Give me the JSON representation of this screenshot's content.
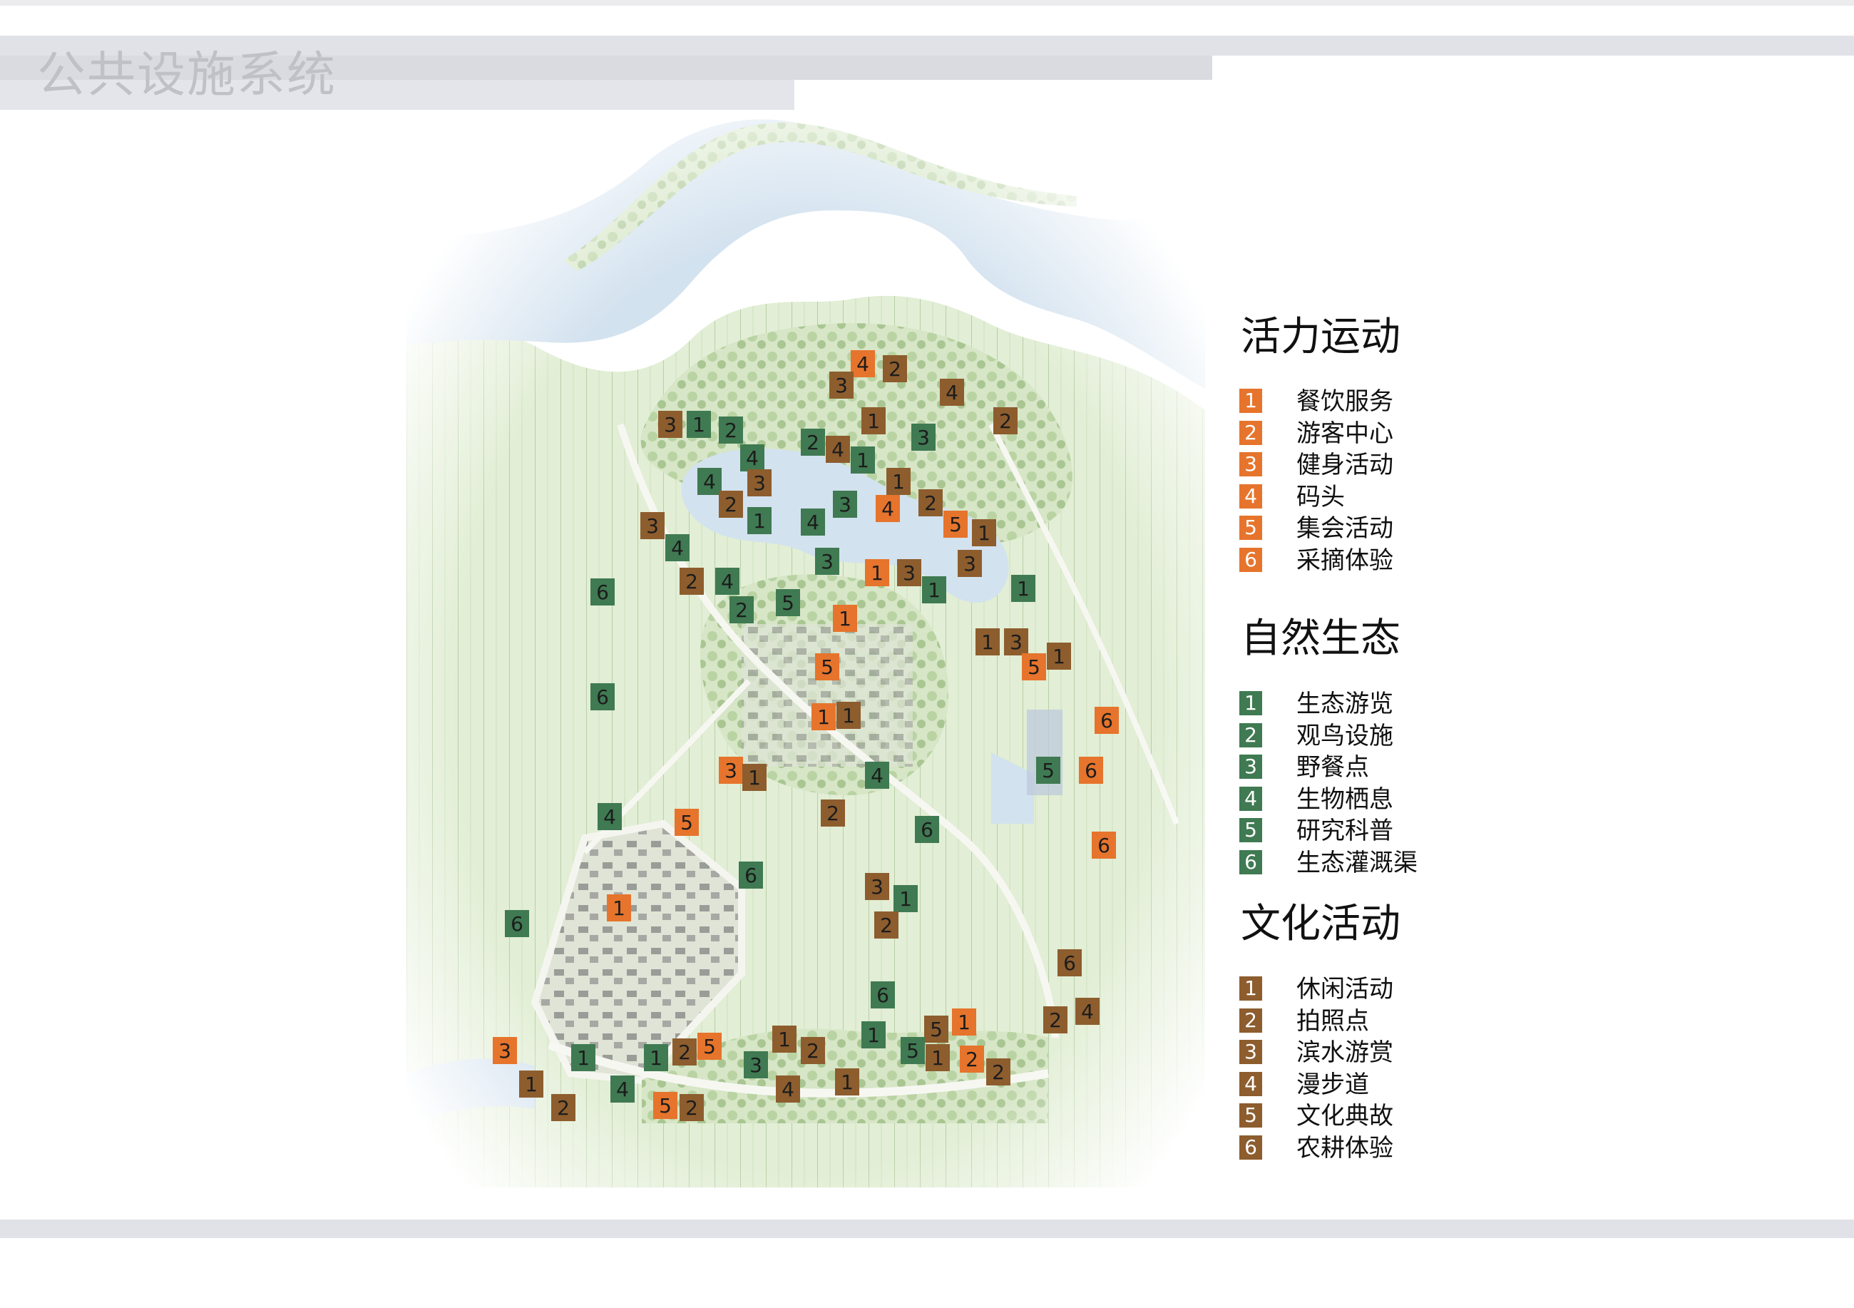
{
  "title": "公共设施系统",
  "colors": {
    "activity": "#e6742c",
    "ecology": "#3f7a52",
    "culture": "#8d5d2e",
    "water": "#d3e2ef",
    "land": "#e4efd8"
  },
  "legend": [
    {
      "key": "activity",
      "heading": "活力运动",
      "color": "#e6742c",
      "items": [
        {
          "num": "1",
          "label": "餐饮服务"
        },
        {
          "num": "2",
          "label": "游客中心"
        },
        {
          "num": "3",
          "label": "健身活动"
        },
        {
          "num": "4",
          "label": "码头"
        },
        {
          "num": "5",
          "label": "集会活动"
        },
        {
          "num": "6",
          "label": "采摘体验"
        }
      ]
    },
    {
      "key": "ecology",
      "heading": "自然生态",
      "color": "#3f7a52",
      "items": [
        {
          "num": "1",
          "label": "生态游览"
        },
        {
          "num": "2",
          "label": "观鸟设施"
        },
        {
          "num": "3",
          "label": "野餐点"
        },
        {
          "num": "4",
          "label": "生物栖息"
        },
        {
          "num": "5",
          "label": "研究科普"
        },
        {
          "num": "6",
          "label": "生态灌溉渠"
        }
      ]
    },
    {
      "key": "culture",
      "heading": "文化活动",
      "color": "#8d5d2e",
      "items": [
        {
          "num": "1",
          "label": "休闲活动"
        },
        {
          "num": "2",
          "label": "拍照点"
        },
        {
          "num": "3",
          "label": "滨水游赏"
        },
        {
          "num": "4",
          "label": "漫步道"
        },
        {
          "num": "5",
          "label": "文化典故"
        },
        {
          "num": "6",
          "label": "农耕体验"
        }
      ]
    }
  ],
  "map_markers": [
    {
      "cat": "activity",
      "num": "4"
    },
    {
      "cat": "culture",
      "num": "2"
    },
    {
      "cat": "culture",
      "num": "3"
    },
    {
      "cat": "culture",
      "num": "4"
    },
    {
      "cat": "culture",
      "num": "2"
    },
    {
      "cat": "culture",
      "num": "3"
    },
    {
      "cat": "ecology",
      "num": "1"
    },
    {
      "cat": "ecology",
      "num": "2"
    },
    {
      "cat": "culture",
      "num": "1"
    },
    {
      "cat": "ecology",
      "num": "4"
    },
    {
      "cat": "ecology",
      "num": "2"
    },
    {
      "cat": "culture",
      "num": "4"
    },
    {
      "cat": "ecology",
      "num": "1"
    },
    {
      "cat": "ecology",
      "num": "3"
    },
    {
      "cat": "ecology",
      "num": "4"
    },
    {
      "cat": "culture",
      "num": "3"
    },
    {
      "cat": "culture",
      "num": "1"
    },
    {
      "cat": "culture",
      "num": "2"
    },
    {
      "cat": "culture",
      "num": "2"
    },
    {
      "cat": "ecology",
      "num": "1"
    },
    {
      "cat": "ecology",
      "num": "4"
    },
    {
      "cat": "ecology",
      "num": "3"
    },
    {
      "cat": "activity",
      "num": "4"
    },
    {
      "cat": "activity",
      "num": "5"
    },
    {
      "cat": "culture",
      "num": "1"
    },
    {
      "cat": "culture",
      "num": "3"
    },
    {
      "cat": "ecology",
      "num": "4"
    },
    {
      "cat": "culture",
      "num": "3"
    },
    {
      "cat": "ecology",
      "num": "3"
    },
    {
      "cat": "activity",
      "num": "1"
    },
    {
      "cat": "culture",
      "num": "3"
    },
    {
      "cat": "culture",
      "num": "2"
    },
    {
      "cat": "ecology",
      "num": "4"
    },
    {
      "cat": "ecology",
      "num": "2"
    },
    {
      "cat": "ecology",
      "num": "5"
    },
    {
      "cat": "ecology",
      "num": "6"
    },
    {
      "cat": "ecology",
      "num": "1"
    },
    {
      "cat": "ecology",
      "num": "1"
    },
    {
      "cat": "activity",
      "num": "1"
    },
    {
      "cat": "culture",
      "num": "1"
    },
    {
      "cat": "culture",
      "num": "3"
    },
    {
      "cat": "activity",
      "num": "5"
    },
    {
      "cat": "culture",
      "num": "1"
    },
    {
      "cat": "activity",
      "num": "5"
    },
    {
      "cat": "ecology",
      "num": "6"
    },
    {
      "cat": "activity",
      "num": "1"
    },
    {
      "cat": "culture",
      "num": "1"
    },
    {
      "cat": "activity",
      "num": "6"
    },
    {
      "cat": "activity",
      "num": "3"
    },
    {
      "cat": "culture",
      "num": "1"
    },
    {
      "cat": "ecology",
      "num": "4"
    },
    {
      "cat": "ecology",
      "num": "5"
    },
    {
      "cat": "activity",
      "num": "6"
    },
    {
      "cat": "culture",
      "num": "2"
    },
    {
      "cat": "ecology",
      "num": "4"
    },
    {
      "cat": "activity",
      "num": "5"
    },
    {
      "cat": "ecology",
      "num": "6"
    },
    {
      "cat": "activity",
      "num": "6"
    },
    {
      "cat": "ecology",
      "num": "6"
    },
    {
      "cat": "culture",
      "num": "3"
    },
    {
      "cat": "ecology",
      "num": "1"
    },
    {
      "cat": "activity",
      "num": "1"
    },
    {
      "cat": "culture",
      "num": "2"
    },
    {
      "cat": "ecology",
      "num": "6"
    },
    {
      "cat": "culture",
      "num": "6"
    },
    {
      "cat": "ecology",
      "num": "6"
    },
    {
      "cat": "culture",
      "num": "2"
    },
    {
      "cat": "culture",
      "num": "4"
    },
    {
      "cat": "culture",
      "num": "5"
    },
    {
      "cat": "activity",
      "num": "1"
    },
    {
      "cat": "activity",
      "num": "3"
    },
    {
      "cat": "culture",
      "num": "1"
    },
    {
      "cat": "culture",
      "num": "2"
    },
    {
      "cat": "ecology",
      "num": "1"
    },
    {
      "cat": "culture",
      "num": "2"
    },
    {
      "cat": "activity",
      "num": "5"
    },
    {
      "cat": "culture",
      "num": "1"
    },
    {
      "cat": "culture",
      "num": "2"
    },
    {
      "cat": "ecology",
      "num": "3"
    },
    {
      "cat": "culture",
      "num": "4"
    },
    {
      "cat": "culture",
      "num": "1"
    },
    {
      "cat": "ecology",
      "num": "1"
    },
    {
      "cat": "ecology",
      "num": "5"
    },
    {
      "cat": "culture",
      "num": "1"
    },
    {
      "cat": "activity",
      "num": "2"
    },
    {
      "cat": "culture",
      "num": "2"
    },
    {
      "cat": "ecology",
      "num": "4"
    },
    {
      "cat": "activity",
      "num": "5"
    },
    {
      "cat": "culture",
      "num": "2"
    },
    {
      "cat": "ecology",
      "num": "1"
    }
  ]
}
